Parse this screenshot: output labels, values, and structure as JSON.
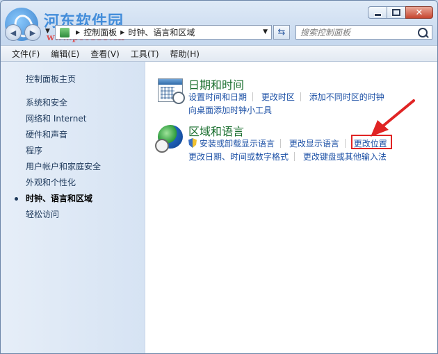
{
  "watermark": {
    "title": "河东软件园",
    "url": "www.pc0359.cn"
  },
  "window": {
    "controls": {
      "minimize": "minimize",
      "maximize": "maximize",
      "close": "✕"
    }
  },
  "address": {
    "crumbs": [
      "控制面板",
      "时钟、语言和区域"
    ],
    "search_placeholder": "搜索控制面板"
  },
  "menu": [
    "文件(F)",
    "编辑(E)",
    "查看(V)",
    "工具(T)",
    "帮助(H)"
  ],
  "left_pane": {
    "home": "控制面板主页",
    "categories": [
      "系统和安全",
      "网络和 Internet",
      "硬件和声音",
      "程序",
      "用户帐户和家庭安全",
      "外观和个性化",
      "时钟、语言和区域",
      "轻松访问"
    ],
    "selected_index": 6
  },
  "groups": [
    {
      "title": "日期和时间",
      "links_row1": [
        "设置时间和日期",
        "更改时区",
        "添加不同时区的时钟"
      ],
      "links_row2": [
        "向桌面添加时钟小工具"
      ]
    },
    {
      "title": "区域和语言",
      "links_row1": [
        "安装或卸载显示语言",
        "更改显示语言",
        "更改位置"
      ],
      "links_row2": [
        "更改日期、时间或数字格式",
        "更改键盘或其他输入法"
      ]
    }
  ],
  "colors": {
    "highlight": "#e02424",
    "group_title": "#1a6e2e",
    "link": "#1d51a6"
  }
}
